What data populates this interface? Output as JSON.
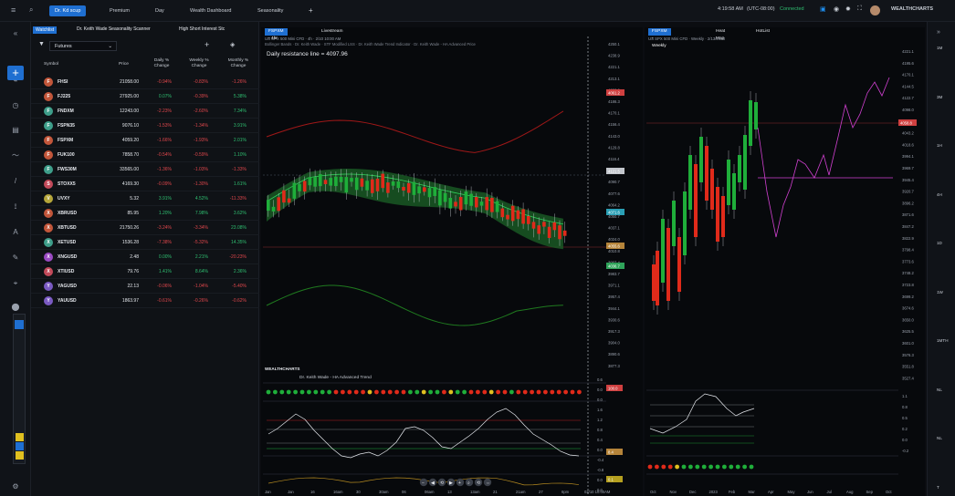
{
  "topbar": {
    "tabs": [
      "Dr. Kd scup",
      "Premium",
      "Day",
      "Wealth Dashboard",
      "Seasonality",
      "+"
    ],
    "clock": "4:19:58 AM",
    "tz": "(UTC-08:00)",
    "status": "Connected",
    "brand": "WEALTHCHARTS"
  },
  "watchlist": {
    "tabs": [
      "Watchlist",
      "Dr. Keith Wade Seasonality Scanner",
      "High Short Interest Stc"
    ],
    "select": "Futures",
    "columns": [
      "Symbol",
      "Price",
      "Daily % Change",
      "Weekly % Change",
      "Monthly % Change"
    ],
    "rows": [
      {
        "l": "F",
        "color": "#c2563a",
        "sym": "FHSI",
        "price": "21058.00",
        "d": "-0.94%",
        "w": "-0.83%",
        "m": "-1.26%"
      },
      {
        "l": "F",
        "color": "#c2563a",
        "sym": "FJ225",
        "price": "27925.00",
        "d": "0.07%",
        "w": "-0.39%",
        "m": "5.38%"
      },
      {
        "l": "F",
        "color": "#3e9e8a",
        "sym": "FNDXM",
        "price": "12243.00",
        "d": "-2.23%",
        "w": "-2.60%",
        "m": "7.34%"
      },
      {
        "l": "F",
        "color": "#3e9e8a",
        "sym": "FSPN35",
        "price": "9076.10",
        "d": "-1.53%",
        "w": "-1.34%",
        "m": "3.91%"
      },
      {
        "l": "F",
        "color": "#c2563a",
        "sym": "FSPXM",
        "price": "4059.20",
        "d": "-1.66%",
        "w": "-1.93%",
        "m": "2.01%"
      },
      {
        "l": "F",
        "color": "#c2563a",
        "sym": "FUK100",
        "price": "7858.70",
        "d": "-0.54%",
        "w": "-0.59%",
        "m": "1.10%"
      },
      {
        "l": "F",
        "color": "#3e9e8a",
        "sym": "FWS30M",
        "price": "33565.00",
        "d": "-1.36%",
        "w": "-1.03%",
        "m": "-1.33%"
      },
      {
        "l": "S",
        "color": "#c24a5a",
        "sym": "STOXX5",
        "price": "4169.30",
        "d": "-0.09%",
        "w": "-1.30%",
        "m": "1.61%"
      },
      {
        "l": "V",
        "color": "#b5a63a",
        "sym": "UVXY",
        "price": "5.32",
        "d": "3.91%",
        "w": "4.52%",
        "m": "-11.33%"
      },
      {
        "l": "X",
        "color": "#c2563a",
        "sym": "XBRUSD",
        "price": "85.95",
        "d": "1.20%",
        "w": "7.98%",
        "m": "3.62%"
      },
      {
        "l": "X",
        "color": "#c2563a",
        "sym": "XBTUSD",
        "price": "21750.26",
        "d": "-3.24%",
        "w": "-3.34%",
        "m": "23.08%"
      },
      {
        "l": "X",
        "color": "#3e9e8a",
        "sym": "XETUSD",
        "price": "1536.28",
        "d": "-7.38%",
        "w": "-5.32%",
        "m": "14.35%"
      },
      {
        "l": "X",
        "color": "#9a4ac2",
        "sym": "XNGUSD",
        "price": "2.48",
        "d": "0.00%",
        "w": "2.21%",
        "m": "-20.23%"
      },
      {
        "l": "X",
        "color": "#c24a5a",
        "sym": "XTIUSD",
        "price": "79.76",
        "d": "1.41%",
        "w": "8.64%",
        "m": "2.36%"
      },
      {
        "l": "Y",
        "color": "#7a5ac2",
        "sym": "YAGUSD",
        "price": "22.13",
        "d": "-0.06%",
        "w": "-1.04%",
        "m": "-5.40%"
      },
      {
        "l": "Y",
        "color": "#7a5ac2",
        "sym": "YAUUSD",
        "price": "1863.97",
        "d": "-0.61%",
        "w": "-0.26%",
        "m": "-0.62%"
      }
    ]
  },
  "chart1": {
    "tabs": [
      "FSPXM - 4hr",
      "Livestream"
    ],
    "subtitle": "US SPX 500 Mini CFD · 4h · 2/10 10:00 AM",
    "indicators": "Bollinger Bands · Dr. Keith Wade · STF Modified LSS · Dr. Keith Wade Trend Indicator · Dr. Keith Wade - HA Advanced Price",
    "annotation": "Daily resistance line = 4097.96",
    "yticks": [
      "4250.1",
      "4238.9",
      "4221.1",
      "4213.1",
      "4200.2",
      "4186.3",
      "4170.1",
      "4156.4",
      "4143.0",
      "4129.8",
      "4116.4",
      "4102.9",
      "4090.7",
      "4077.6",
      "4064.2",
      "4050.7",
      "4037.1",
      "4024.0",
      "4010.8",
      "3997.4",
      "3983.7",
      "3971.1",
      "3957.4",
      "3944.1",
      "3930.6",
      "3917.3",
      "3904.0",
      "3890.6",
      "3877.3"
    ],
    "price_tags": [
      {
        "v": "4121.5",
        "c": "#c2c6cc"
      },
      {
        "v": "4061.2",
        "c": "#d04040"
      },
      {
        "v": "4071.6",
        "c": "#2a9fb5"
      },
      {
        "v": "4055.6",
        "c": "#b5843a"
      },
      {
        "v": "4036.7",
        "c": "#2fa35a"
      }
    ],
    "xticks": [
      "Jan",
      "Jan",
      "16",
      "16am",
      "30",
      "30am",
      "06",
      "06am",
      "13",
      "13am",
      "21",
      "21am",
      "27",
      "6pm",
      "02/10 10:00AM"
    ],
    "indicator_title": "Dr. Keith Wade - HA Advanced Trend",
    "sub_ticks": [
      "0.6",
      "0.0",
      "0.0",
      "1.6",
      "1.2",
      "0.8",
      "0.4",
      "0.0",
      "-0.4",
      "-0.8",
      "0.0",
      "0.0"
    ],
    "sub_tags": [
      "100.0",
      "8.4",
      "0.1"
    ]
  },
  "chart2": {
    "tabs": [
      "FSPXM - Weekly",
      "Heat Map",
      "HotList"
    ],
    "subtitle": "US SPX 500 Mini CFD · Weekly · 2/13/2023",
    "yticks": [
      "4221.1",
      "4195.6",
      "4170.1",
      "4144.5",
      "4122.7",
      "4098.0",
      "4070.6",
      "4043.2",
      "4018.6",
      "3994.1",
      "3969.7",
      "3945.4",
      "3920.7",
      "3896.2",
      "3871.6",
      "3847.2",
      "3822.9",
      "3798.4",
      "3773.6",
      "3748.2",
      "3723.8",
      "3699.2",
      "3674.6",
      "3650.0",
      "3625.5",
      "3601.0",
      "3576.3",
      "3551.8",
      "3527.4"
    ],
    "price_tag": "4058.8",
    "xticks": [
      "Oct",
      "Nov",
      "Dec",
      "2023",
      "Feb",
      "Mar",
      "Apr",
      "May",
      "Jun",
      "Jul",
      "Aug",
      "Sep",
      "Oct"
    ],
    "sub_ticks": [
      "1.1",
      "0.8",
      "0.5",
      "0.2",
      "0.0",
      "-0.2"
    ]
  },
  "rightnav": [
    "1M",
    "3M",
    "1H",
    "4H",
    "1D",
    "1W",
    "1MTH",
    "NL",
    "NL",
    "T"
  ]
}
